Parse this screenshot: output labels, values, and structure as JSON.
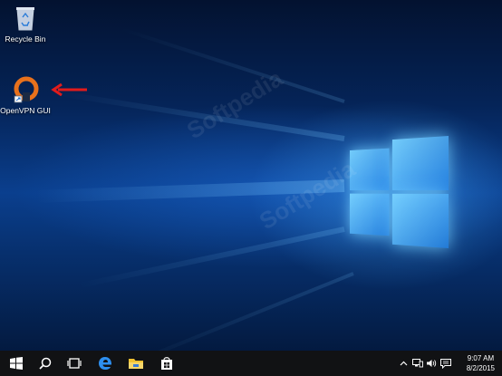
{
  "desktop": {
    "icons": [
      {
        "label": "Recycle Bin"
      },
      {
        "label": "OpenVPN GUI"
      }
    ]
  },
  "taskbar": {
    "buttons": [
      "start-icon",
      "search-icon",
      "task-view-icon",
      "edge-icon",
      "file-explorer-icon",
      "store-icon"
    ],
    "tray": [
      "chevron-up-icon",
      "network-icon",
      "volume-icon",
      "action-center-icon"
    ],
    "clock": {
      "time": "9:07 AM",
      "date": "8/2/2015"
    }
  },
  "colors": {
    "accent": "#e8711c",
    "taskbar": "#111214",
    "arrow": "#e21b1b"
  }
}
